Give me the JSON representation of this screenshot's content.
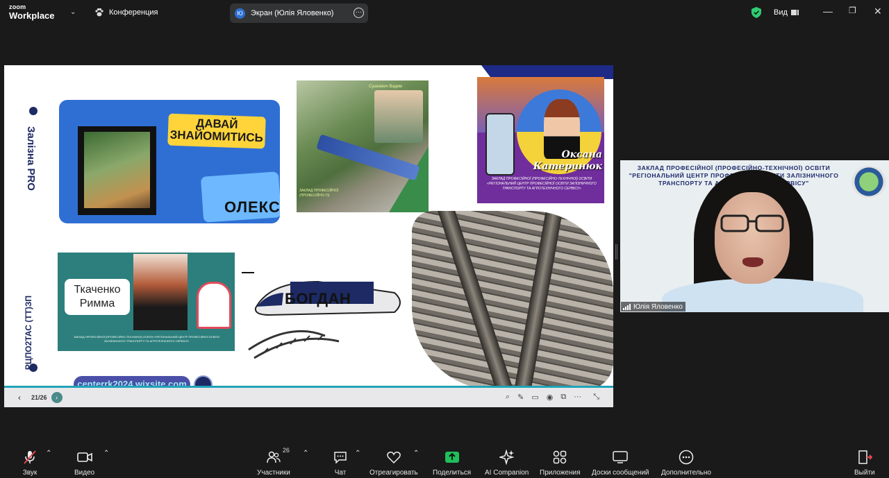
{
  "app": {
    "logo_top": "zoom",
    "logo_bottom": "Workplace",
    "meeting_title": "Конференция",
    "share_avatar": "Ю",
    "share_label": "Экран (Юлія Яловенко)",
    "view_label": "Вид"
  },
  "slide": {
    "vertical_title_1": "Залізна PRO",
    "vertical_title_2": "РЦПО2ТАС (ТТ)ЗП",
    "card1_sticker": "ДАВАЙ ЗНАЙОМИТИСЬ",
    "card1_name": "ОЛЕКС",
    "card2_header": "Сушкевич Вадим",
    "card2_caption": "ЗАКЛАД ПРОФЕСІЙНОЇ (ПРОФЕСІЙНО-ТЕ",
    "card3_name_1": "Оксана",
    "card3_name_2": "Катеринюк",
    "card3_caption": "ЗАКЛАД ПРОФЕСІЙНОЇ (ПРОФЕСІЙНО-ТЕХНІЧНОЇ) ОСВІТИ «РЕГІОНАЛЬНИЙ ЦЕНТР ПРОФЕСІЙНОЇ ОСВІТИ ЗАЛІЗНИЧНОГО ТРАНСПОРТУ ТА АГРОТЕХНІЧНОГО СЕРВІСУ»",
    "card4_name_1": "Ткаченко",
    "card4_name_2": "Римма",
    "card4_caption": "ЗАКЛАД ПРОФЕСІЙНОЇ (ПРОФЕСІЙНО-ТЕХНІЧНОЇ) ОСВІТИ «РЕГІОНАЛЬНИЙ ЦЕНТР ПРОФЕСІЙНОЇ ОСВІТИ ЗАЛІЗНИЧНОГО ТРАНСПОРТУ ТА АГРОТЕХНІЧНОГО СЕРВІСУ»",
    "card5_name": "БОГДАН",
    "url": "centerrk2024.wixsite.com",
    "page_counter": "21/26"
  },
  "video": {
    "banner": "ЗАКЛАД ПРОФЕСІЙНОЇ (ПРОФЕСІЙНО-ТЕХНІЧНОЇ) ОСВІТИ \"РЕГІОНАЛЬНИЙ ЦЕНТР ПРОФЕСІЙНОЇ ОСВІТИ ЗАЛІЗНИЧНОГО ТРАНСПОРТУ ТА АГРОТЕХНІЧНОГО СЕРВІСУ\"",
    "participant_name": "Юлія Яловенко"
  },
  "toolbar": {
    "audio": "Звук",
    "video": "Видео",
    "participants": "Участники",
    "participants_count": "26",
    "chat": "Чат",
    "react": "Отреагировать",
    "share": "Поделиться",
    "ai": "AI Companion",
    "apps": "Приложения",
    "whiteboards": "Доски сообщений",
    "more": "Дополнительно",
    "leave": "Выйти"
  },
  "colors": {
    "share_green": "#1fbf5a",
    "leave_red": "#e5484d",
    "shield_green": "#2ecc71"
  }
}
